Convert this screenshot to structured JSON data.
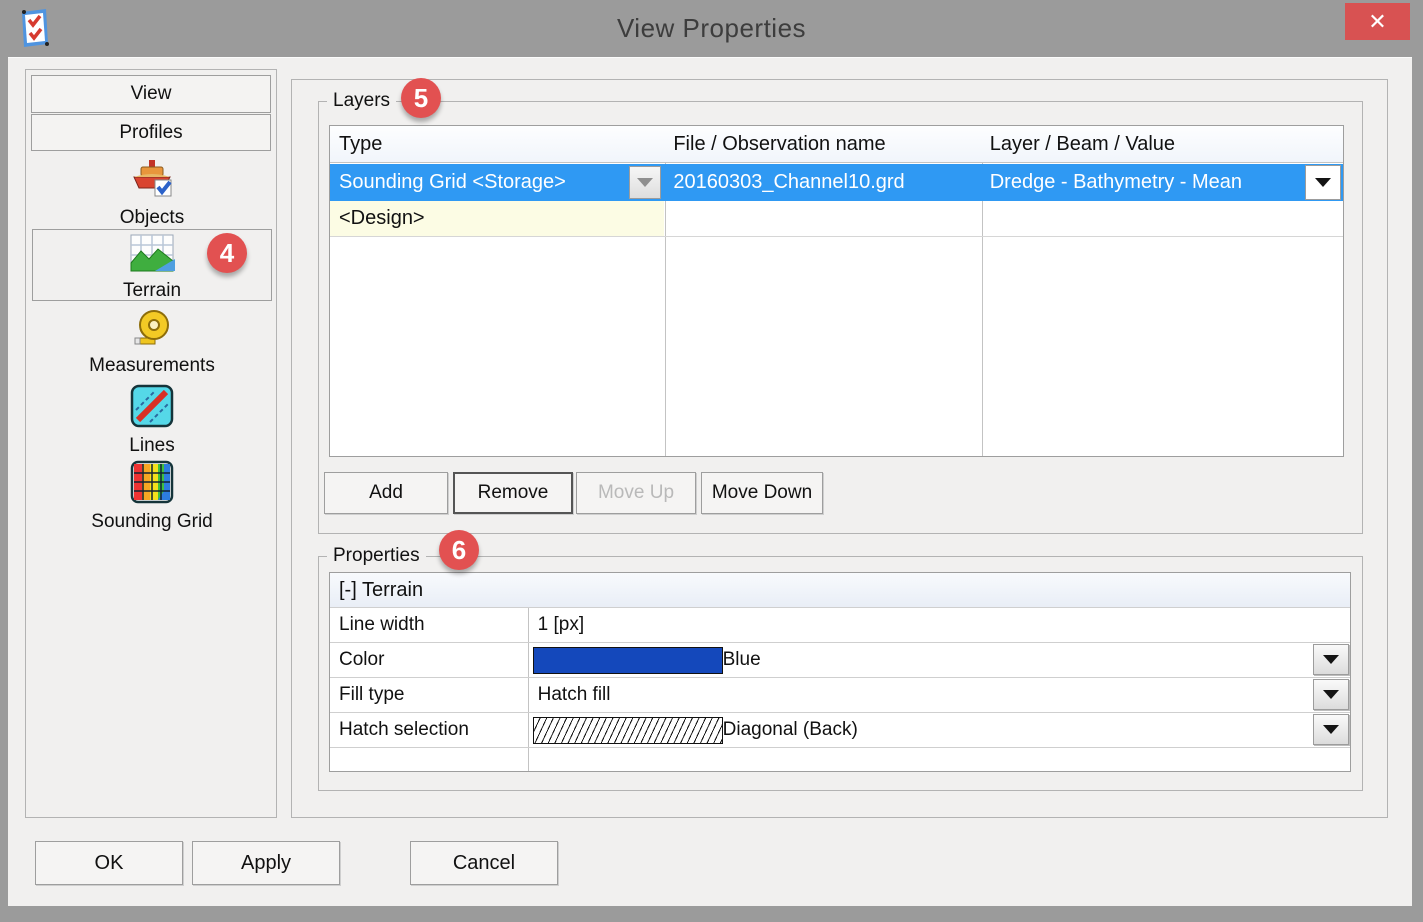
{
  "window": {
    "title": "View Properties",
    "close_glyph": "✕"
  },
  "sidebar": {
    "buttons": [
      {
        "label": "View"
      },
      {
        "label": "Profiles"
      }
    ],
    "items": [
      {
        "label": "Objects",
        "icon": "boat-icon"
      },
      {
        "label": "Terrain",
        "icon": "terrain-icon",
        "selected": true,
        "badge": "4"
      },
      {
        "label": "Measurements",
        "icon": "tape-measure-icon"
      },
      {
        "label": "Lines",
        "icon": "lines-icon"
      },
      {
        "label": "Sounding Grid",
        "icon": "sounding-grid-icon"
      }
    ]
  },
  "layers": {
    "group_label": "Layers",
    "badge": "5",
    "table": {
      "columns": [
        "Type",
        "File / Observation name",
        "Layer / Beam / Value"
      ],
      "rows": [
        {
          "type": "Sounding Grid <Storage>",
          "file": "20160303_Channel10.grd",
          "layer": "Dredge - Bathymetry - Mean",
          "selected": true
        },
        {
          "type": "<Design>",
          "file": "",
          "layer": ""
        }
      ]
    },
    "buttons": [
      {
        "label": "Add",
        "enabled": true
      },
      {
        "label": "Remove",
        "enabled": true,
        "focused": true
      },
      {
        "label": "Move Up",
        "enabled": false
      },
      {
        "label": "Move Down",
        "enabled": true
      }
    ]
  },
  "properties": {
    "group_label": "Properties",
    "badge": "6",
    "header": "[-] Terrain",
    "swatch_style": "background:#1448bb",
    "rows": [
      {
        "label": "Line width",
        "value": "1 [px]"
      },
      {
        "label": "Color",
        "value": "Blue",
        "swatch_color": "#1448bb",
        "dropdown": true
      },
      {
        "label": "Fill type",
        "value": "Hatch fill",
        "dropdown": true
      },
      {
        "label": "Hatch selection",
        "value": "Diagonal (Back)",
        "swatch": "diagonal-hatch",
        "dropdown": true
      }
    ]
  },
  "footer": {
    "buttons": [
      {
        "label": "OK"
      },
      {
        "label": "Apply"
      },
      {
        "label": "Cancel"
      }
    ]
  },
  "colors": {
    "titlebar": "#9b9b9b",
    "close_button": "#d85252",
    "selection_blue": "#2f99f3",
    "badge_red": "#e25151",
    "row_yellow": "#fcfce4",
    "swatch_blue": "#1448bb"
  }
}
